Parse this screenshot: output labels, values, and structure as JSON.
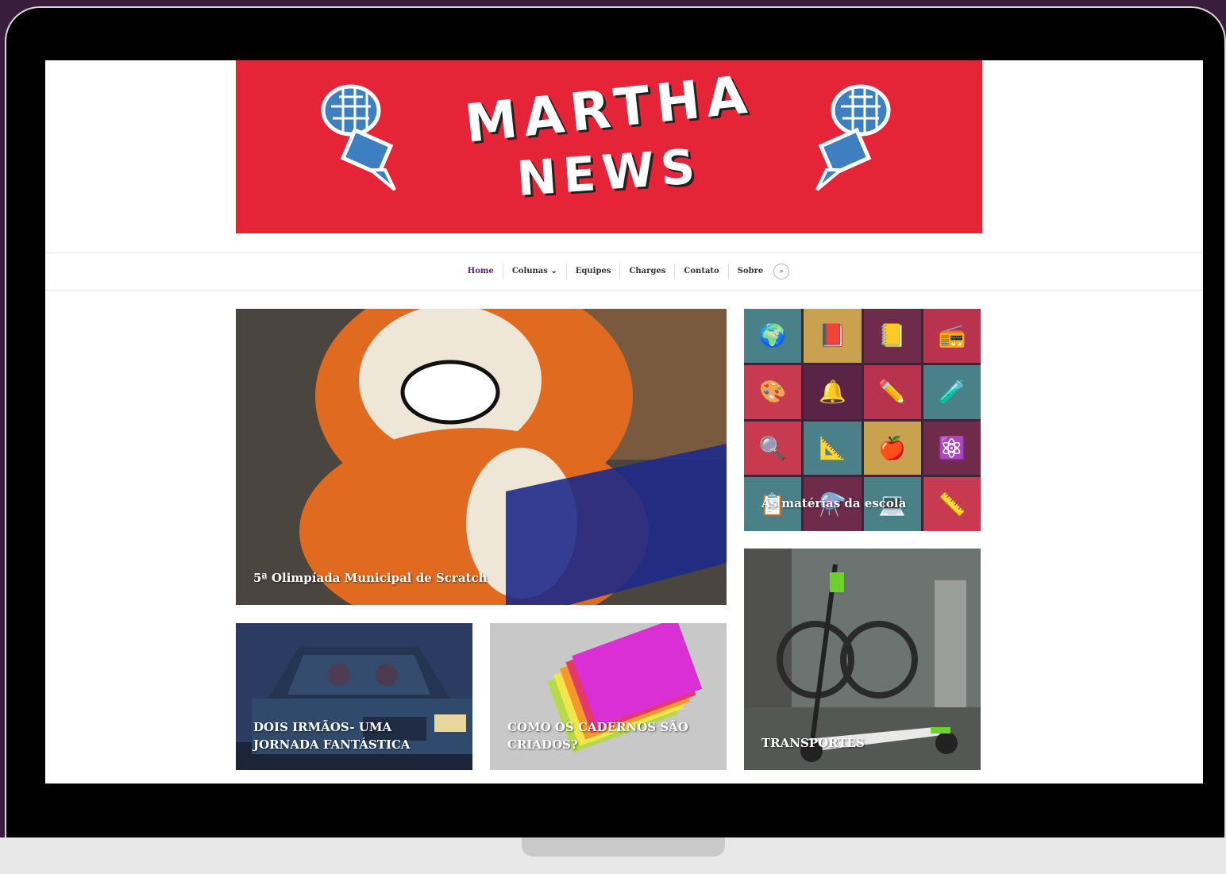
{
  "colors": {
    "banner": "#e52537",
    "brand_purple": "#5b1d7c",
    "frame_bg": "#3a1d3d"
  },
  "banner": {
    "logo_line1": "MARTHA",
    "logo_line2": "NEWS"
  },
  "nav": {
    "items": [
      {
        "label": "Home",
        "active": true
      },
      {
        "label": "Colunas ⌄"
      },
      {
        "label": "Equipes"
      },
      {
        "label": "Charges"
      },
      {
        "label": "Contato"
      },
      {
        "label": "Sobre"
      }
    ],
    "search_icon": "search-icon"
  },
  "posts": [
    {
      "title": "5ª Olimpíada Municipal de Scratch"
    },
    {
      "title": "As matérias da escola"
    },
    {
      "title": "DOIS IRMÃOS- UMA JORNADA FANTÁSTICA"
    },
    {
      "title": "COMO OS CADERNOS SÃO CRIADOS?"
    },
    {
      "title": "TRANSPORTES"
    }
  ],
  "tiles": [
    {
      "icon": "globe-icon",
      "glyph": "🌍",
      "color": "#4a8088"
    },
    {
      "icon": "book-icon",
      "glyph": "📕",
      "color": "#c9a24f"
    },
    {
      "icon": "notepad-icon",
      "glyph": "📒",
      "color": "#6e2b4a"
    },
    {
      "icon": "radio-icon",
      "glyph": "📻",
      "color": "#b8344e"
    },
    {
      "icon": "palette-icon",
      "glyph": "🎨",
      "color": "#c73a50"
    },
    {
      "icon": "bell-icon",
      "glyph": "🔔",
      "color": "#5a2446"
    },
    {
      "icon": "pencil-icon",
      "glyph": "✏️",
      "color": "#b8344e"
    },
    {
      "icon": "flask-icon",
      "glyph": "🧪",
      "color": "#4a8088"
    },
    {
      "icon": "magnifier-icon",
      "glyph": "🔍",
      "color": "#c73a50"
    },
    {
      "icon": "compass-icon",
      "glyph": "📐",
      "color": "#4a8088"
    },
    {
      "icon": "apple-icon",
      "glyph": "🍎",
      "color": "#c9a24f"
    },
    {
      "icon": "atom-icon",
      "glyph": "⚛️",
      "color": "#6e2b4a"
    },
    {
      "icon": "chalkboard-icon",
      "glyph": "📋",
      "color": "#4a8088"
    },
    {
      "icon": "chemistry-icon",
      "glyph": "⚗️",
      "color": "#6e2b4a"
    },
    {
      "icon": "laptop-icon",
      "glyph": "💻",
      "color": "#4a8088"
    },
    {
      "icon": "ruler-icon",
      "glyph": "📏",
      "color": "#c73a50"
    }
  ]
}
